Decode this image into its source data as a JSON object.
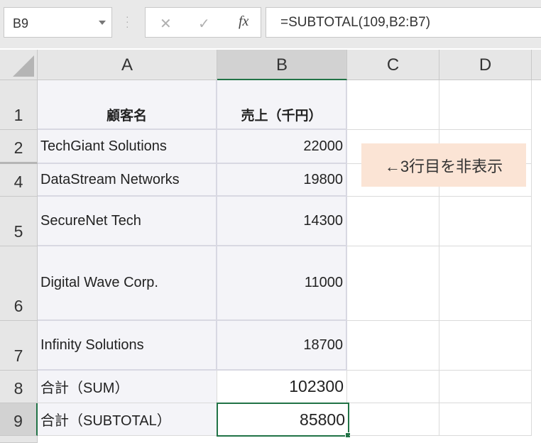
{
  "formula_bar": {
    "name_box": "B9",
    "cancel_icon": "✕",
    "enter_icon": "✓",
    "fx_label": "fx",
    "formula": "=SUBTOTAL(109,B2:B7)"
  },
  "columns": [
    "A",
    "B",
    "C",
    "D"
  ],
  "rows": [
    {
      "num": "1",
      "a": "顧客名",
      "b": "売上（千円）"
    },
    {
      "num": "2",
      "a": "TechGiant Solutions",
      "b": "22000"
    },
    {
      "num": "4",
      "a": "DataStream Networks",
      "b": "19800"
    },
    {
      "num": "5",
      "a": "SecureNet Tech",
      "b": "14300"
    },
    {
      "num": "6",
      "a": "Digital Wave Corp.",
      "b": "11000"
    },
    {
      "num": "7",
      "a": "Infinity Solutions",
      "b": "18700"
    },
    {
      "num": "8",
      "a": "合計（SUM）",
      "b": "102300"
    },
    {
      "num": "9",
      "a": "合計（SUBTOTAL）",
      "b": "85800"
    }
  ],
  "note": "←3行目を非表示",
  "colors": {
    "accent": "#217346",
    "note_bg": "#fbe4d5",
    "table_shade": "#f4f4f8"
  },
  "icons": [
    "dropdown-icon",
    "cancel-icon",
    "enter-icon",
    "fx-icon",
    "select-all-icon",
    "fill-handle-icon"
  ]
}
